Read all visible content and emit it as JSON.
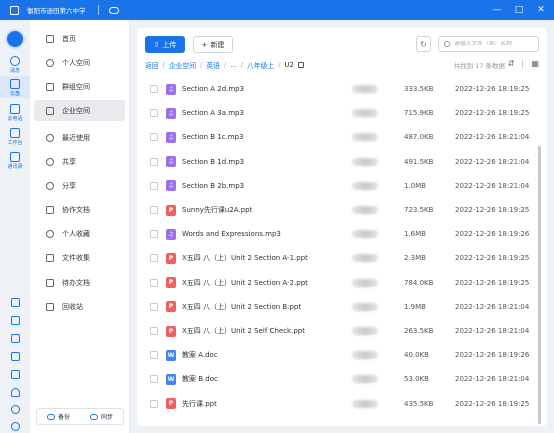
{
  "window": {
    "title": "衡阳市迪田第六中学",
    "controls": [
      "minimize",
      "maximize",
      "close"
    ]
  },
  "rail": {
    "items": [
      {
        "label": "消息",
        "icon": "message-icon"
      },
      {
        "label": "云盘",
        "icon": "cloud-disk-icon",
        "active": true
      },
      {
        "label": "云电话",
        "icon": "phone-icon"
      },
      {
        "label": "工作台",
        "icon": "workbench-icon"
      },
      {
        "label": "通讯录",
        "icon": "contacts-icon"
      }
    ],
    "bottom_icons": [
      "mail-icon",
      "calendar-icon",
      "note-icon",
      "check-icon",
      "book-icon",
      "gem-icon",
      "globe-icon",
      "settings-icon"
    ]
  },
  "sidebar": {
    "items": [
      {
        "label": "首页",
        "icon": "home-icon"
      },
      {
        "label": "个人空间",
        "icon": "person-icon"
      },
      {
        "label": "群组空间",
        "icon": "group-icon"
      },
      {
        "label": "企业空间",
        "icon": "folder-icon",
        "active": true
      },
      {
        "label": "最近使用",
        "icon": "recent-icon"
      },
      {
        "label": "共享",
        "icon": "share-icon"
      },
      {
        "label": "分享",
        "icon": "link-share-icon"
      },
      {
        "label": "协作文档",
        "icon": "collab-doc-icon"
      },
      {
        "label": "个人收藏",
        "icon": "star-icon"
      },
      {
        "label": "文件收集",
        "icon": "collect-icon"
      },
      {
        "label": "待办文档",
        "icon": "todo-icon"
      },
      {
        "label": "回收站",
        "icon": "trash-icon"
      }
    ],
    "backup_label": "备份",
    "sync_label": "同步"
  },
  "toolbar": {
    "upload_label": "上传",
    "new_label": "新建",
    "search_placeholder": "请输入文件（夹）名称"
  },
  "breadcrumb": {
    "back": "返回",
    "items": [
      "企业空间",
      "英语",
      "...",
      "八年级上"
    ],
    "current": "U2"
  },
  "count_text": "共找到 17 条数据",
  "files": [
    {
      "name": "Section A 2d.mp3",
      "type": "mp3",
      "size": "333.5KB",
      "date": "2022-12-26 18:19:25"
    },
    {
      "name": "Section A 3a.mp3",
      "type": "mp3",
      "size": "715.9KB",
      "date": "2022-12-26 18:19:25"
    },
    {
      "name": "Section B 1c.mp3",
      "type": "mp3",
      "size": "487.0KB",
      "date": "2022-12-26 18:21:04"
    },
    {
      "name": "Section B 1d.mp3",
      "type": "mp3",
      "size": "491.5KB",
      "date": "2022-12-26 18:21:04"
    },
    {
      "name": "Section B 2b.mp3",
      "type": "mp3",
      "size": "1.0MB",
      "date": "2022-12-26 18:21:04"
    },
    {
      "name": "Sunny先行课u2A.ppt",
      "type": "ppt",
      "size": "723.5KB",
      "date": "2022-12-26 18:19:25"
    },
    {
      "name": "Words and Expressions.mp3",
      "type": "mp3",
      "size": "1.6MB",
      "date": "2022-12-26 18:19:26"
    },
    {
      "name": "X五四 八（上）Unit 2 Section A-1.ppt",
      "type": "ppt",
      "size": "2.3MB",
      "date": "2022-12-26 18:19:25"
    },
    {
      "name": "X五四 八（上）Unit 2 Section A-2.ppt",
      "type": "ppt",
      "size": "784.0KB",
      "date": "2022-12-26 18:19:25"
    },
    {
      "name": "X五四 八（上）Unit 2 Section B.ppt",
      "type": "ppt",
      "size": "1.9MB",
      "date": "2022-12-26 18:21:04"
    },
    {
      "name": "X五四 八（上）Unit 2 Self Check.ppt",
      "type": "ppt",
      "size": "263.5KB",
      "date": "2022-12-26 18:21:04"
    },
    {
      "name": "教案 A.doc",
      "type": "doc",
      "size": "40.0KB",
      "date": "2022-12-26 18:19:26"
    },
    {
      "name": "教案 B.doc",
      "type": "doc",
      "size": "53.0KB",
      "date": "2022-12-26 18:21:04"
    },
    {
      "name": "先行课.ppt",
      "type": "ppt",
      "size": "435.5KB",
      "date": "2022-12-26 18:19:25"
    }
  ]
}
